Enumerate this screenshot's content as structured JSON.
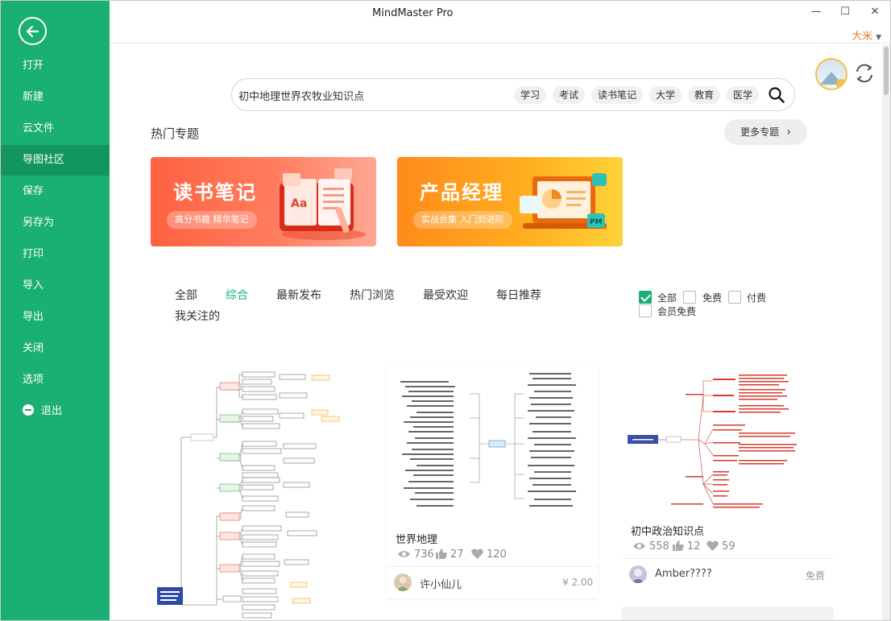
{
  "app": {
    "title": "MindMaster Pro",
    "user": "大米"
  },
  "window": {
    "minimize": "—",
    "maximize": "☐",
    "close": "✕"
  },
  "sidebar": {
    "items": [
      {
        "label": "打开"
      },
      {
        "label": "新建"
      },
      {
        "label": "云文件"
      },
      {
        "label": "导图社区",
        "active": true
      },
      {
        "label": "保存"
      },
      {
        "label": "另存为"
      },
      {
        "label": "打印"
      },
      {
        "label": "导入"
      },
      {
        "label": "导出"
      },
      {
        "label": "关闭"
      },
      {
        "label": "选项"
      },
      {
        "label": "退出"
      }
    ]
  },
  "search": {
    "value": "初中地理世界农牧业知识点",
    "tags": [
      "学习",
      "考试",
      "读书笔记",
      "大学",
      "教育",
      "医学"
    ]
  },
  "hot": {
    "title": "热门专题",
    "more": "更多专题",
    "banners": [
      {
        "title": "读书笔记",
        "subtitle": "高分书籍 精华笔记"
      },
      {
        "title": "产品经理",
        "subtitle": "实战合集 入门到进阶"
      }
    ]
  },
  "filters": {
    "tabs": [
      "全部",
      "综合",
      "最新发布",
      "热门浏览",
      "最受欢迎",
      "每日推荐",
      "我关注的"
    ],
    "active_tab": "综合",
    "price_options": [
      {
        "label": "全部",
        "checked": true
      },
      {
        "label": "免费",
        "checked": false
      },
      {
        "label": "付费",
        "checked": false
      },
      {
        "label": "会员免费",
        "checked": false
      }
    ]
  },
  "cards": [
    {
      "title": "世界地理",
      "views": "736",
      "likes": "27",
      "favs": "120",
      "author": "许小仙儿",
      "price": "¥ 2.00"
    },
    {
      "title": "初中政治知识点",
      "views": "558",
      "likes": "12",
      "favs": "59",
      "author": "Amber????",
      "price": "免费"
    }
  ],
  "colors": {
    "accent": "#1aaf73",
    "sidebar": "#1aaf73",
    "sidebar_active": "#12955f",
    "user": "#e8832a"
  }
}
